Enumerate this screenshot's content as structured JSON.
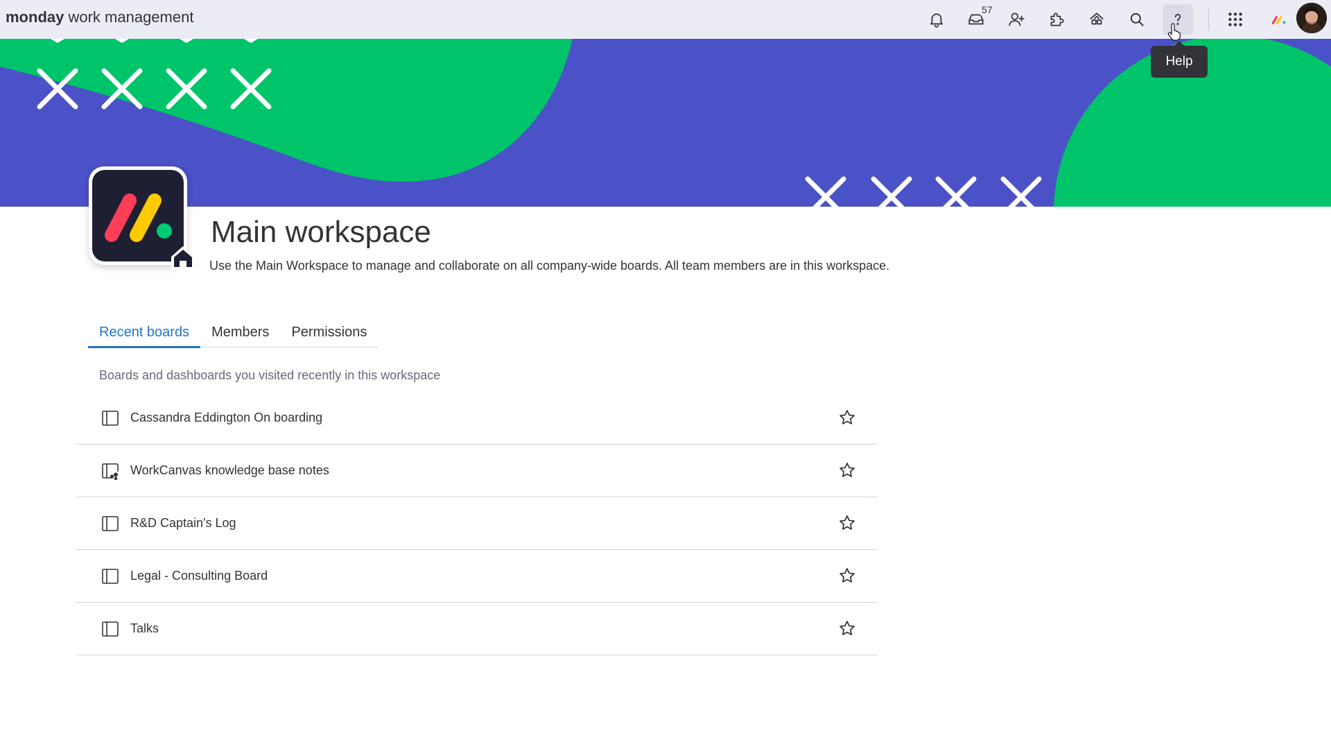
{
  "topbar": {
    "brand_bold": "monday",
    "brand_light": " work management",
    "icons": [
      "notifications-bell-icon",
      "inbox-icon",
      "invite-members-icon",
      "apps-marketplace-icon",
      "workspaces-icon",
      "search-icon",
      "help-icon",
      "app-switcher-icon",
      "monday-products-icon",
      "user-avatar"
    ],
    "inbox_count": "57",
    "help_tooltip": "Help"
  },
  "colors": {
    "banner_blue": "#4b51c6",
    "banner_green": "#00c46a",
    "accent_blue": "#1f76c2",
    "logo_red": "#ff3d57",
    "logo_yellow": "#ffcb00",
    "logo_green": "#00ca72"
  },
  "workspace": {
    "title": "Main workspace",
    "description": "Use the Main Workspace to manage and collaborate on all company-wide boards. All team members are in this workspace."
  },
  "tabs": [
    {
      "label": "Recent boards",
      "active": true
    },
    {
      "label": "Members",
      "active": false
    },
    {
      "label": "Permissions",
      "active": false
    }
  ],
  "recent": {
    "caption": "Boards and dashboards you visited recently in this workspace",
    "boards": [
      {
        "name": "Cassandra Eddington On boarding",
        "icon": "board-icon"
      },
      {
        "name": "WorkCanvas knowledge base notes",
        "icon": "shared-board-icon"
      },
      {
        "name": "R&D Captain's Log",
        "icon": "board-icon"
      },
      {
        "name": "Legal - Consulting Board",
        "icon": "board-icon"
      },
      {
        "name": "Talks",
        "icon": "board-icon"
      }
    ]
  }
}
